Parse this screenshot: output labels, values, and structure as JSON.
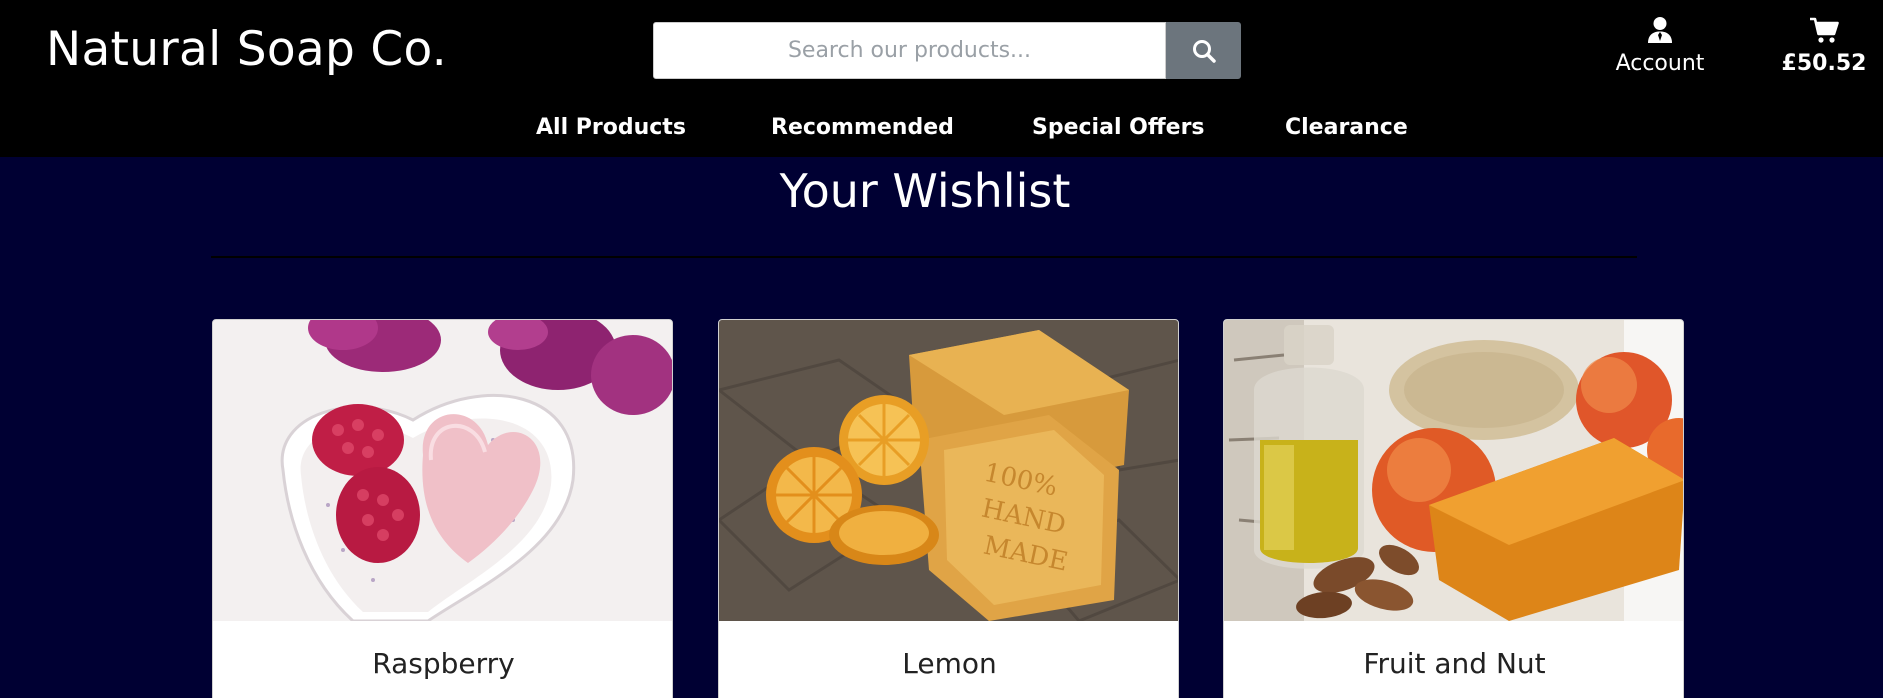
{
  "header": {
    "logo": "Natural Soap Co.",
    "search": {
      "placeholder": "Search our products..."
    },
    "account_label": "Account",
    "cart_total": "£50.52"
  },
  "nav": {
    "items": [
      {
        "label": "All Products"
      },
      {
        "label": "Recommended"
      },
      {
        "label": "Special Offers"
      },
      {
        "label": "Clearance"
      }
    ]
  },
  "main": {
    "title": "Your Wishlist",
    "products": [
      {
        "name": "Raspberry",
        "image": "raspberry-soap-photo"
      },
      {
        "name": "Lemon",
        "image": "lemon-soap-photo"
      },
      {
        "name": "Fruit and Nut",
        "image": "fruit-and-nut-soap-photo"
      }
    ]
  },
  "colors": {
    "header_bg": "#000000",
    "page_bg": "#000033",
    "search_button": "#6c757d",
    "card_bg": "#ffffff"
  },
  "icons": [
    "search-icon",
    "user-icon",
    "cart-icon"
  ]
}
